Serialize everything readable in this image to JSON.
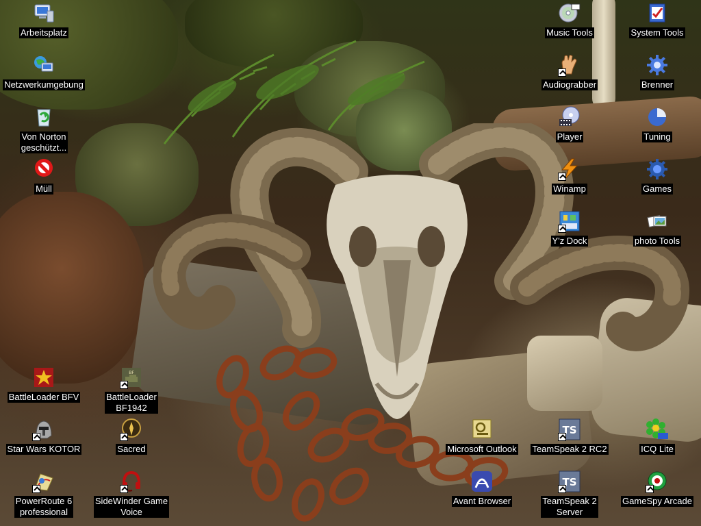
{
  "desktop": {
    "icons": {
      "arbeitsplatz": {
        "label": "Arbeitsplatz",
        "icon": "my-computer-icon"
      },
      "netzwerk": {
        "label": "Netzwerkumgebung",
        "icon": "network-icon"
      },
      "norton": {
        "label": "Von Norton\ngeschützt...",
        "icon": "recycle-bin-icon"
      },
      "muell": {
        "label": "Müll",
        "icon": "no-entry-icon"
      },
      "bfv": {
        "label": "BattleLoader BFV",
        "icon": "star-badge-icon"
      },
      "bf1942": {
        "label": "BattleLoader\nBF1942",
        "icon": "battlefield-icon"
      },
      "kotor": {
        "label": "Star Wars KOTOR",
        "icon": "helmet-icon"
      },
      "sacred": {
        "label": "Sacred",
        "icon": "sacred-orb-icon"
      },
      "powerroute": {
        "label": "PowerRoute 6\nprofessional",
        "icon": "route-icon"
      },
      "sidewinder": {
        "label": "SideWinder Game\nVoice",
        "icon": "headset-icon"
      },
      "musictools": {
        "label": "Music Tools",
        "icon": "cd-icon"
      },
      "systemtools": {
        "label": "System Tools",
        "icon": "clipboard-icon"
      },
      "audiograbber": {
        "label": "Audiograbber",
        "icon": "hand-icon"
      },
      "brenner": {
        "label": "Brenner",
        "icon": "gear-icon"
      },
      "player": {
        "label": "Player",
        "icon": "disc-film-icon"
      },
      "tuning": {
        "label": "Tuning",
        "icon": "pie-chart-icon"
      },
      "winamp": {
        "label": "Winamp",
        "icon": "lightning-icon"
      },
      "games": {
        "label": "Games",
        "icon": "gear-blue-icon"
      },
      "yzdock": {
        "label": "Y'z Dock",
        "icon": "dock-icon"
      },
      "phototools": {
        "label": "photo Tools",
        "icon": "photos-icon"
      },
      "outlook": {
        "label": "Microsoft Outlook",
        "icon": "outlook-icon"
      },
      "ts2rc2": {
        "label": "TeamSpeak 2 RC2",
        "icon": "teamspeak-icon"
      },
      "icq": {
        "label": "ICQ Lite",
        "icon": "flower-icon"
      },
      "avant": {
        "label": "Avant Browser",
        "icon": "avant-icon"
      },
      "ts2server": {
        "label": "TeamSpeak 2\nServer",
        "icon": "teamspeak-icon"
      },
      "gamespy": {
        "label": "GameSpy Arcade",
        "icon": "gamespy-icon"
      }
    }
  }
}
